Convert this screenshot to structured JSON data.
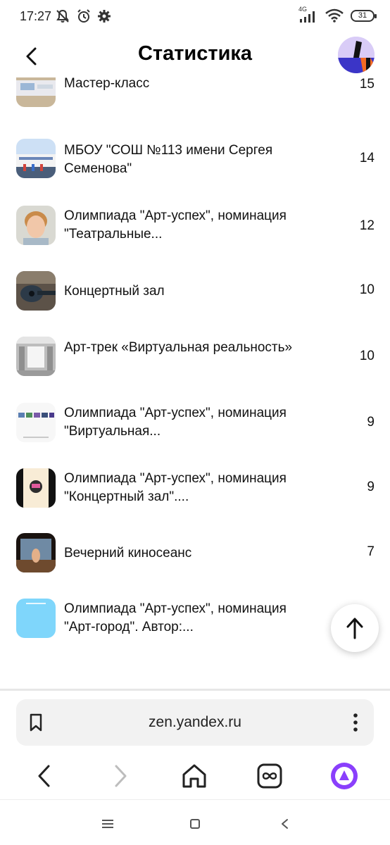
{
  "status_bar": {
    "time": "17:27",
    "network_label": "4G",
    "battery": "31"
  },
  "header": {
    "title": "Статистика"
  },
  "items": [
    {
      "title": "Мастер-класс",
      "count": "15",
      "thumb": "photo-table-icon"
    },
    {
      "title": "МБОУ \"СОШ №113 имени Сергея Семенова\"",
      "count": "14",
      "thumb": "photo-school-building-icon"
    },
    {
      "title": "Олимпиада \"Арт-успех\", номинация \"Театральные...",
      "count": "12",
      "thumb": "photo-child-portrait-icon"
    },
    {
      "title": "Концертный зал",
      "count": "10",
      "thumb": "photo-guitar-icon"
    },
    {
      "title": "Арт-трек «Виртуальная реальность»",
      "count": "10",
      "thumb": "photo-hall-interior-icon"
    },
    {
      "title": "Олимпиада \"Арт-успех\", номинация \"Виртуальная...",
      "count": "9",
      "thumb": "photo-gallery-grid-icon"
    },
    {
      "title": "Олимпиада \"Арт-успех\", номинация \"Концертный зал\"....",
      "count": "9",
      "thumb": "photo-poster-icon"
    },
    {
      "title": "Вечерний киносеанс",
      "count": "7",
      "thumb": "photo-stage-performance-icon"
    },
    {
      "title": "Олимпиада \"Арт-успех\", номинация \"Арт-город\". Автор:...",
      "count": "",
      "thumb": "photo-blue-card-icon"
    }
  ],
  "browser": {
    "url": "zen.yandex.ru"
  },
  "colors": {
    "alice_purple": "#8a3ffc",
    "url_bar_bg": "#f2f2f2"
  }
}
